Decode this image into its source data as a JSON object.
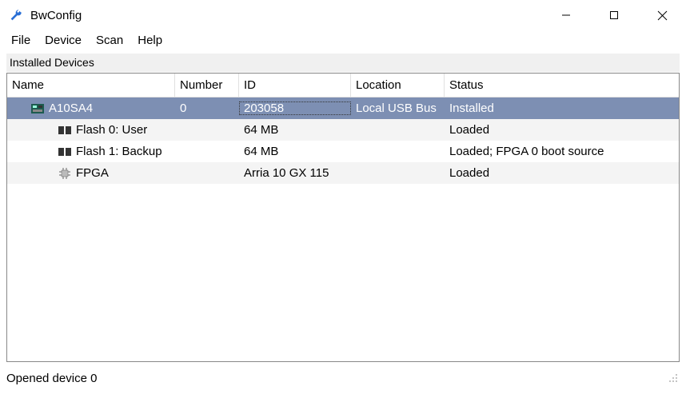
{
  "app": {
    "title": "BwConfig"
  },
  "menu": {
    "file": "File",
    "device": "Device",
    "scan": "Scan",
    "help": "Help"
  },
  "group": {
    "label": "Installed Devices"
  },
  "columns": {
    "name": "Name",
    "number": "Number",
    "id": "ID",
    "location": "Location",
    "status": "Status"
  },
  "rows": [
    {
      "name": "A10SA4",
      "number": "0",
      "id": "203058",
      "location": "Local USB Bus",
      "status": "Installed",
      "indent": 0,
      "icon": "board-icon",
      "selected": true,
      "alt": false
    },
    {
      "name": "Flash 0: User",
      "number": "",
      "id": "64 MB",
      "location": "",
      "status": "Loaded",
      "indent": 1,
      "icon": "flash-icon",
      "selected": false,
      "alt": true
    },
    {
      "name": "Flash 1: Backup",
      "number": "",
      "id": "64 MB",
      "location": "",
      "status": "Loaded; FPGA 0 boot source",
      "indent": 1,
      "icon": "flash-icon",
      "selected": false,
      "alt": false
    },
    {
      "name": "FPGA",
      "number": "",
      "id": "Arria 10 GX 115",
      "location": "",
      "status": "Loaded",
      "indent": 1,
      "icon": "chip-icon",
      "selected": false,
      "alt": true
    }
  ],
  "statusbar": {
    "text": "Opened device 0"
  }
}
